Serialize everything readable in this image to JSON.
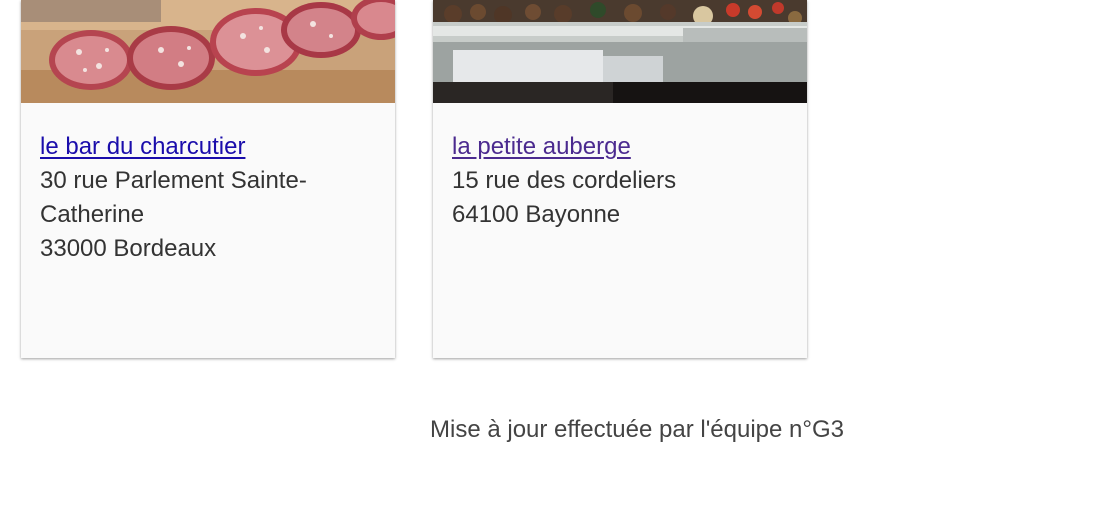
{
  "cards": [
    {
      "title": "le bar du charcutier",
      "address_lines": [
        "30 rue Parlement Sainte-",
        "Catherine",
        "33000 Bordeaux"
      ],
      "image": "sliced-saucisson-photo",
      "link_state": "unvisited",
      "link_color": "#1a0dab"
    },
    {
      "title": "la petite auberge",
      "address_lines": [
        "15 rue des cordeliers",
        "64100 Bayonne"
      ],
      "image": "restaurant-dish-photo",
      "link_state": "visited",
      "link_color": "#4b2a8f"
    }
  ],
  "footer": {
    "text": "Mise à jour effectuée par l'équipe n°G3"
  }
}
